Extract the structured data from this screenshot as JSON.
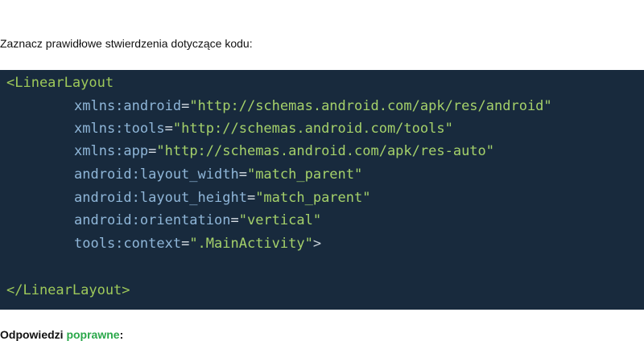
{
  "question": "Zaznacz prawidłowe stwierdzenia dotyczące kodu:",
  "code": {
    "open_tag": "<LinearLayout",
    "attributes": [
      {
        "name": "xmlns:android",
        "value": "\"http://schemas.android.com/apk/res/android\""
      },
      {
        "name": "xmlns:tools",
        "value": "\"http://schemas.android.com/tools\""
      },
      {
        "name": "xmlns:app",
        "value": "\"http://schemas.android.com/apk/res-auto\""
      },
      {
        "name": "android:layout_width",
        "value": "\"match_parent\""
      },
      {
        "name": "android:layout_height",
        "value": "\"match_parent\""
      },
      {
        "name": "android:orientation",
        "value": "\"vertical\""
      },
      {
        "name": "tools:context",
        "value": "\".MainActivity\""
      }
    ],
    "open_tag_end": ">",
    "close_tag": "</LinearLayout>"
  },
  "answers": {
    "prefix": "Odpowiedzi ",
    "highlight": "poprawne",
    "suffix": ":"
  },
  "colors": {
    "code_bg": "#182a3d",
    "tag": "#9ec95a",
    "attribute": "#8fb6d8",
    "string": "#a5d16a",
    "highlight": "#2aa84a"
  }
}
